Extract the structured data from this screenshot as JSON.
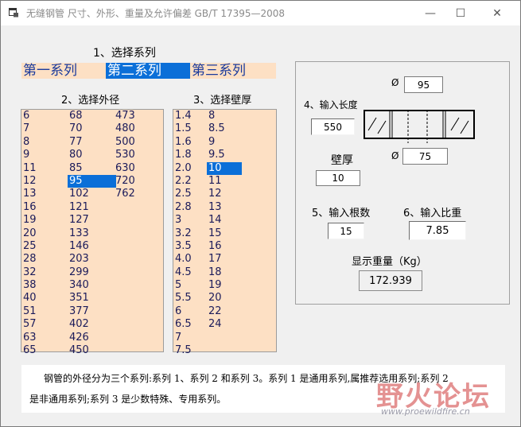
{
  "window": {
    "title": "无缝钢管 尺寸、外形、重量及允许偏差 GB/T 17395—2008",
    "minimize_glyph": "—",
    "maximize_glyph": "☐",
    "close_glyph": "✕"
  },
  "series": {
    "heading": "1、选择系列",
    "options": [
      "第一系列",
      "第二系列",
      "第三系列"
    ],
    "selected": "第二系列"
  },
  "outer_diameter": {
    "heading": "2、选择外径",
    "columns": [
      [
        "6",
        "7",
        "8",
        "9",
        "11",
        "12",
        "13",
        "16",
        "19",
        "20",
        "25",
        "28",
        "32",
        "38",
        "40",
        "51",
        "57",
        "63",
        "65"
      ],
      [
        "68",
        "70",
        "77",
        "80",
        "85",
        "95",
        "102",
        "121",
        "127",
        "133",
        "146",
        "203",
        "299",
        "340",
        "351",
        "377",
        "402",
        "426",
        "450"
      ],
      [
        "473",
        "480",
        "500",
        "530",
        "630",
        "720",
        "762"
      ]
    ],
    "selected": "95"
  },
  "wall_thickness": {
    "heading": "3、选择壁厚",
    "columns": [
      [
        "1.4",
        "1.5",
        "1.6",
        "1.8",
        "2.0",
        "2.2",
        "2.5",
        "2.8",
        "3",
        "3.2",
        "3.5",
        "4.0",
        "4.5",
        "5",
        "5.5",
        "6",
        "6.5",
        "7",
        "7.5"
      ],
      [
        "8",
        "8.5",
        "9",
        "9.5",
        "10",
        "11",
        "12",
        "13",
        "14",
        "15",
        "16",
        "17",
        "18",
        "19",
        "20",
        "22",
        "24"
      ]
    ],
    "selected": "10"
  },
  "diagram": {
    "length_label": "4、输入长度",
    "length_value": "550",
    "outer_symbol": "Ø",
    "outer_value": "95",
    "inner_symbol": "Ø",
    "inner_value": "75",
    "wall_label": "壁厚",
    "wall_value": "10"
  },
  "count": {
    "label": "5、输入根数",
    "value": "15"
  },
  "density": {
    "label": "6、输入比重",
    "value": "7.85"
  },
  "weight": {
    "label": "显示重量（Kg）",
    "value": "172.939"
  },
  "description": {
    "line1": "钢管的外径分为三个系列:系列 1、系列 2 和系列 3。系列 1 是通用系列,属推荐选用系列;系列 2",
    "line2": "是非通用系列;系列 3 是少数特殊、专用系列。"
  },
  "watermark": {
    "text": "野火论坛",
    "url": "www.proewildfire.cn"
  },
  "colors": {
    "list_bg": "#fde0c4",
    "selection": "#0b6fd8",
    "list_text": "#1a1a5a"
  }
}
